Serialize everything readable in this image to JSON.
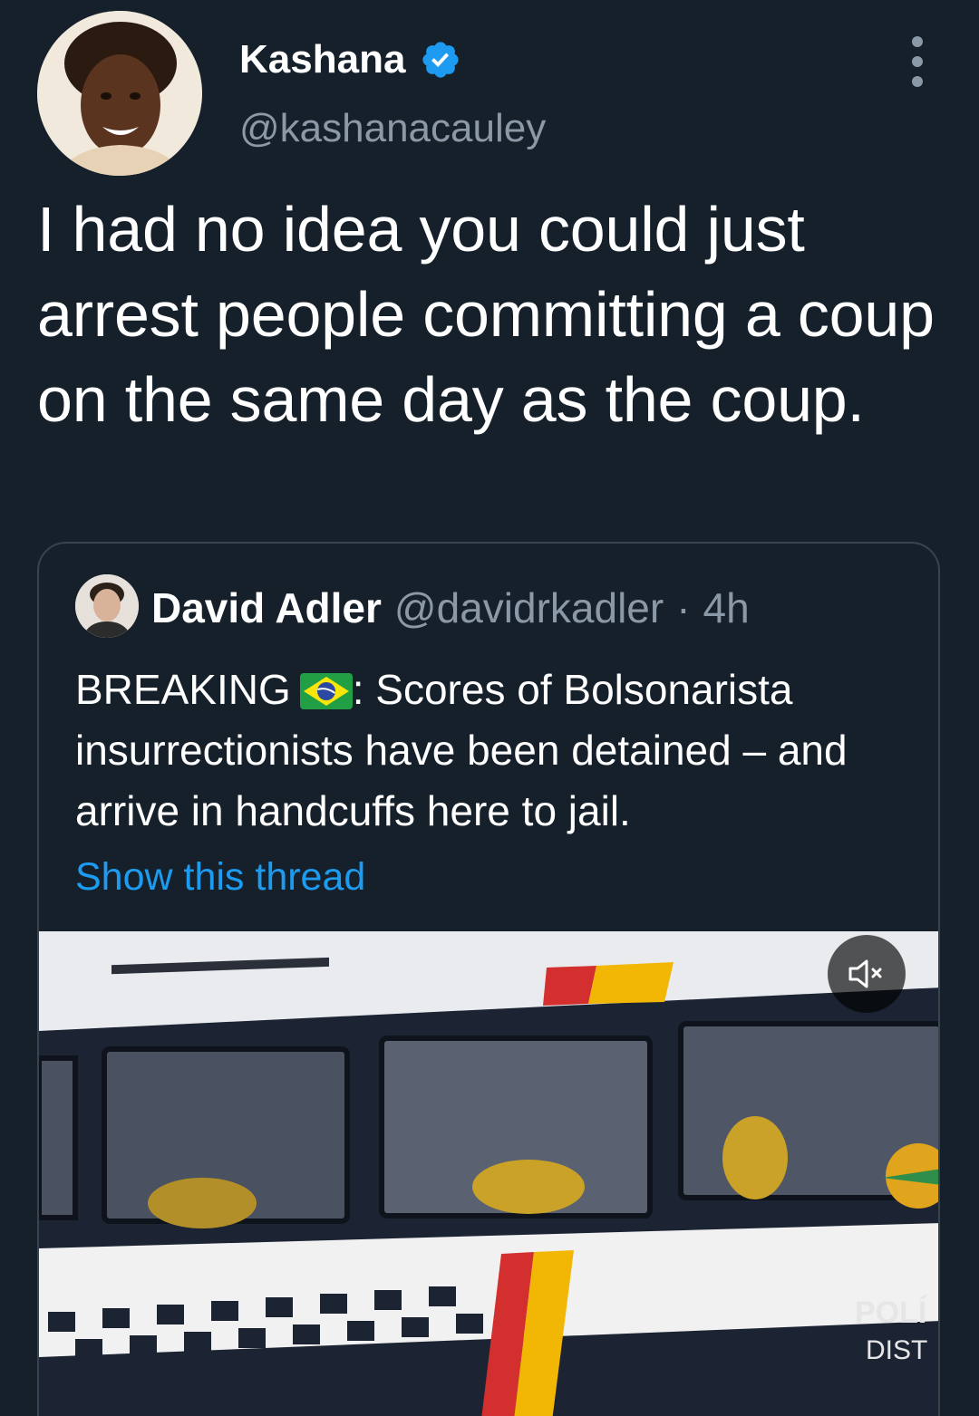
{
  "tweet": {
    "author": {
      "display_name": "Kashana",
      "handle": "@kashanacauley",
      "verified": true
    },
    "text": "I had no idea you could just arrest people committing a coup on the same day as the coup.",
    "more_icon": "more-vertical-icon"
  },
  "quoted_tweet": {
    "author": {
      "display_name": "David Adler",
      "handle": "@davidrkadler",
      "separator": "·",
      "time": "4h"
    },
    "text_before_flag": "BREAKING",
    "flag_icon": "brazil-flag-icon",
    "text_after_flag": ": Scores of Bolsonarista insurrectionists have been detained – and arrive in handcuffs here to jail.",
    "show_thread_label": "Show this thread",
    "media": {
      "type": "video",
      "overlay_text_line1": "POLÍ",
      "overlay_text_line2": "DIST",
      "mute_icon": "volume-muted-icon"
    }
  },
  "colors": {
    "background": "#15202b",
    "text_primary": "#ffffff",
    "text_secondary": "#8b98a5",
    "accent": "#1d9bf0",
    "border": "#38444d"
  }
}
